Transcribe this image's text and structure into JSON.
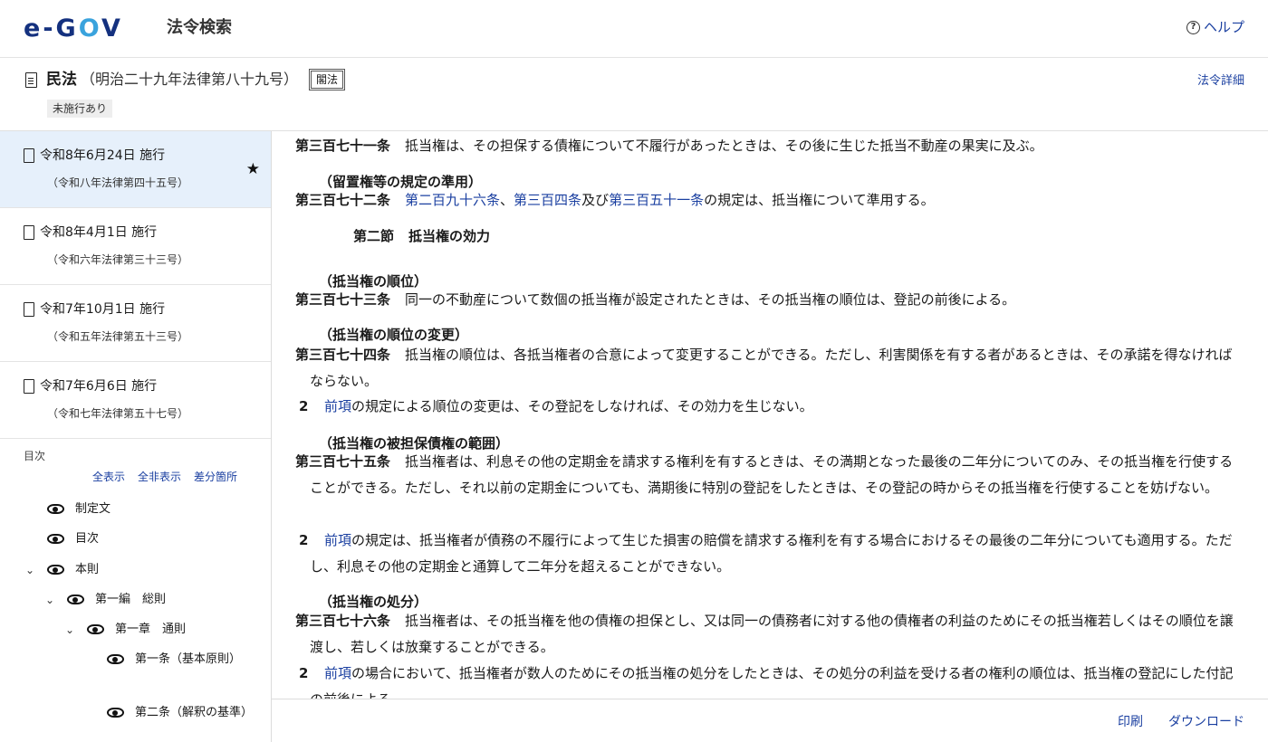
{
  "header": {
    "logo_e": "e",
    "logo_dash": "-",
    "logo_g": "G",
    "logo_o": "O",
    "logo_v": "V",
    "app_title": "法令検索",
    "help_label": "ヘルプ"
  },
  "law": {
    "name": "民法",
    "number": "（明治二十九年法律第八十九号）",
    "tag": "閣法",
    "status": "未施行あり",
    "detail_link": "法令詳細"
  },
  "versions": [
    {
      "date": "令和8年6月24日 施行",
      "num": "（令和八年法律第四十五号）",
      "active": true
    },
    {
      "date": "令和8年4月1日 施行",
      "num": "（令和六年法律第三十三号）"
    },
    {
      "date": "令和7年10月1日 施行",
      "num": "（令和五年法律第五十三号）"
    },
    {
      "date": "令和7年6月6日 施行",
      "num": "（令和七年法律第五十七号）"
    }
  ],
  "toc": {
    "label": "目次",
    "show_all": "全表示",
    "hide_all": "全非表示",
    "diff": "差分箇所",
    "items": [
      {
        "text": "制定文"
      },
      {
        "text": "目次"
      },
      {
        "text": "本則"
      },
      {
        "text": "第一編　総則"
      },
      {
        "text": "第一章　通則"
      },
      {
        "text": "第一条（基本原則）"
      },
      {
        "text": "第二条（解釈の基準）"
      }
    ]
  },
  "content": {
    "a371_num": "第三百七十一条",
    "a371_text": "抵当権は、その担保する債権について不履行があったときは、その後に生じた抵当不動産の果実に及ぶ。",
    "a372_caption": "（留置権等の規定の準用）",
    "a372_num": "第三百七十二条",
    "a372_link1": "第二百九十六条",
    "a372_sep1": "、",
    "a372_link2": "第三百四条",
    "a372_sep2": "及び",
    "a372_link3": "第三百五十一条",
    "a372_rest": "の規定は、抵当権について準用する。",
    "sec_num": "第二節",
    "sec_title": "抵当権の効力",
    "a373_caption": "（抵当権の順位）",
    "a373_num": "第三百七十三条",
    "a373_text": "同一の不動産について数個の抵当権が設定されたときは、その抵当権の順位は、登記の前後による。",
    "a374_caption": "（抵当権の順位の変更）",
    "a374_num": "第三百七十四条",
    "a374_text": "抵当権の順位は、各抵当権者の合意によって変更することができる。ただし、利害関係を有する者があるときは、その承諾を得なければならない。",
    "a374_p2_num": "2",
    "a374_p2_link": "前項",
    "a374_p2_text": "の規定による順位の変更は、その登記をしなければ、その効力を生じない。",
    "a375_caption": "（抵当権の被担保債権の範囲）",
    "a375_num": "第三百七十五条",
    "a375_text": "抵当権者は、利息その他の定期金を請求する権利を有するときは、その満期となった最後の二年分についてのみ、その抵当権を行使することができる。ただし、それ以前の定期金についても、満期後に特別の登記をしたときは、その登記の時からその抵当権を行使することを妨げない。",
    "a375_p2_num": "2",
    "a375_p2_link": "前項",
    "a375_p2_text": "の規定は、抵当権者が債務の不履行によって生じた損害の賠償を請求する権利を有する場合におけるその最後の二年分についても適用する。ただし、利息その他の定期金と通算して二年分を超えることができない。",
    "a376_caption": "（抵当権の処分）",
    "a376_num": "第三百七十六条",
    "a376_text": "抵当権者は、その抵当権を他の債権の担保とし、又は同一の債務者に対する他の債権者の利益のためにその抵当権若しくはその順位を譲渡し、若しくは放棄することができる。",
    "a376_p2_num": "2",
    "a376_p2_link": "前項",
    "a376_p2_text": "の場合において、抵当権者が数人のためにその抵当権の処分をしたときは、その処分の利益を受ける者の権利の順位は、抵当権の登記にした付記の前後による。"
  },
  "footer": {
    "print": "印刷",
    "download": "ダウンロード"
  }
}
